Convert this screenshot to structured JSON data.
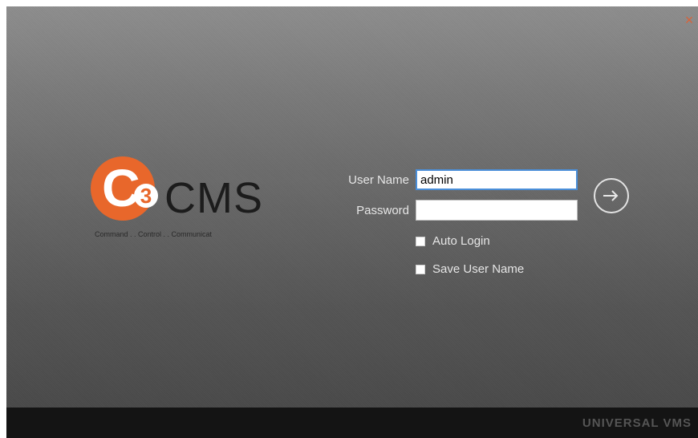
{
  "window": {
    "close_glyph": "×"
  },
  "logo": {
    "letter": "C",
    "number": "3",
    "name": "CMS",
    "tagline": "Command . . Control . . Communicat",
    "accent_color": "#e8672b"
  },
  "login": {
    "username_label": "User Name",
    "username_value": "admin",
    "password_label": "Password",
    "password_value": "",
    "auto_login_label": "Auto Login",
    "auto_login_checked": false,
    "save_username_label": "Save User Name",
    "save_username_checked": false,
    "submit_icon": "login-arrow-icon"
  },
  "footer": {
    "brand": "UNIVERSAL VMS"
  }
}
